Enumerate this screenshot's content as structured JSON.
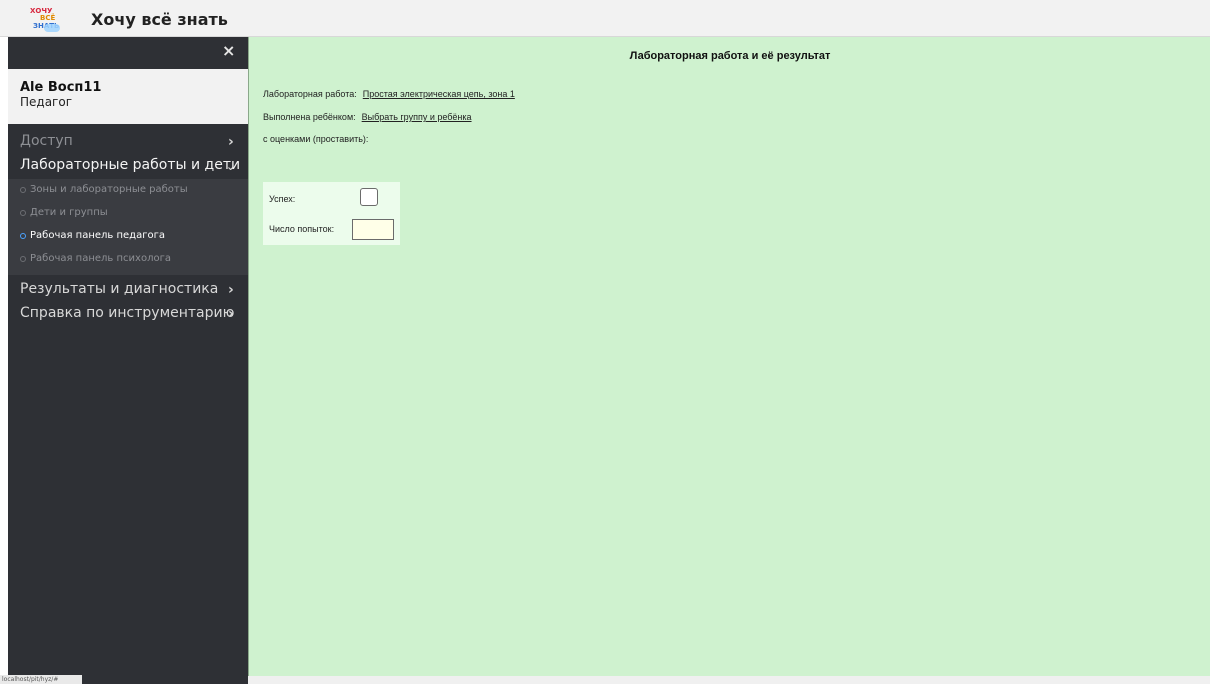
{
  "header": {
    "app_title": "Хочу всё знать",
    "logo_text": [
      "ХОЧУ",
      "ВСЁ",
      "ЗНАТЬ"
    ]
  },
  "sidebar": {
    "close_icon": "×",
    "user": {
      "name": "Ale Восп11",
      "role": "Педагог"
    },
    "items": [
      {
        "label": "Доступ",
        "icon": "chevron-right-icon",
        "glyph": "›"
      },
      {
        "label": "Лабораторные работы и дети",
        "icon": "chevron-down-icon",
        "glyph": "⌄"
      },
      {
        "label": "Результаты и диагностика",
        "icon": "chevron-right-icon",
        "glyph": "›"
      },
      {
        "label": "Справка по инструментарию",
        "icon": "chevron-right-icon",
        "glyph": "›"
      }
    ],
    "subitems": [
      {
        "label": "Зоны и лабораторные работы",
        "active": false
      },
      {
        "label": "Дети и группы",
        "active": false
      },
      {
        "label": "Рабочая панель педагога",
        "active": true
      },
      {
        "label": "Рабочая панель психолога",
        "active": false
      }
    ],
    "accent_color": "#4aa3ff"
  },
  "main": {
    "heading": "Лабораторная работа и её результат",
    "lab_work_label": "Лабораторная работа:",
    "lab_work_link": "Простая электрическая цепь, зона 1",
    "done_by_label": "Выполнена ребёнком:",
    "done_by_link": "Выбрать группу и ребёнка",
    "grades_label": "с оценками (проставить):",
    "success_label": "Успех:",
    "attempts_label": "Число попыток:",
    "attempts_value": ""
  },
  "status_bar": {
    "url": "localhost/pit/hyz/#"
  },
  "colors": {
    "sidebar_bg": "#2e3035",
    "main_bg": "#cff2cf",
    "grade_box_bg": "#ecfcec"
  }
}
